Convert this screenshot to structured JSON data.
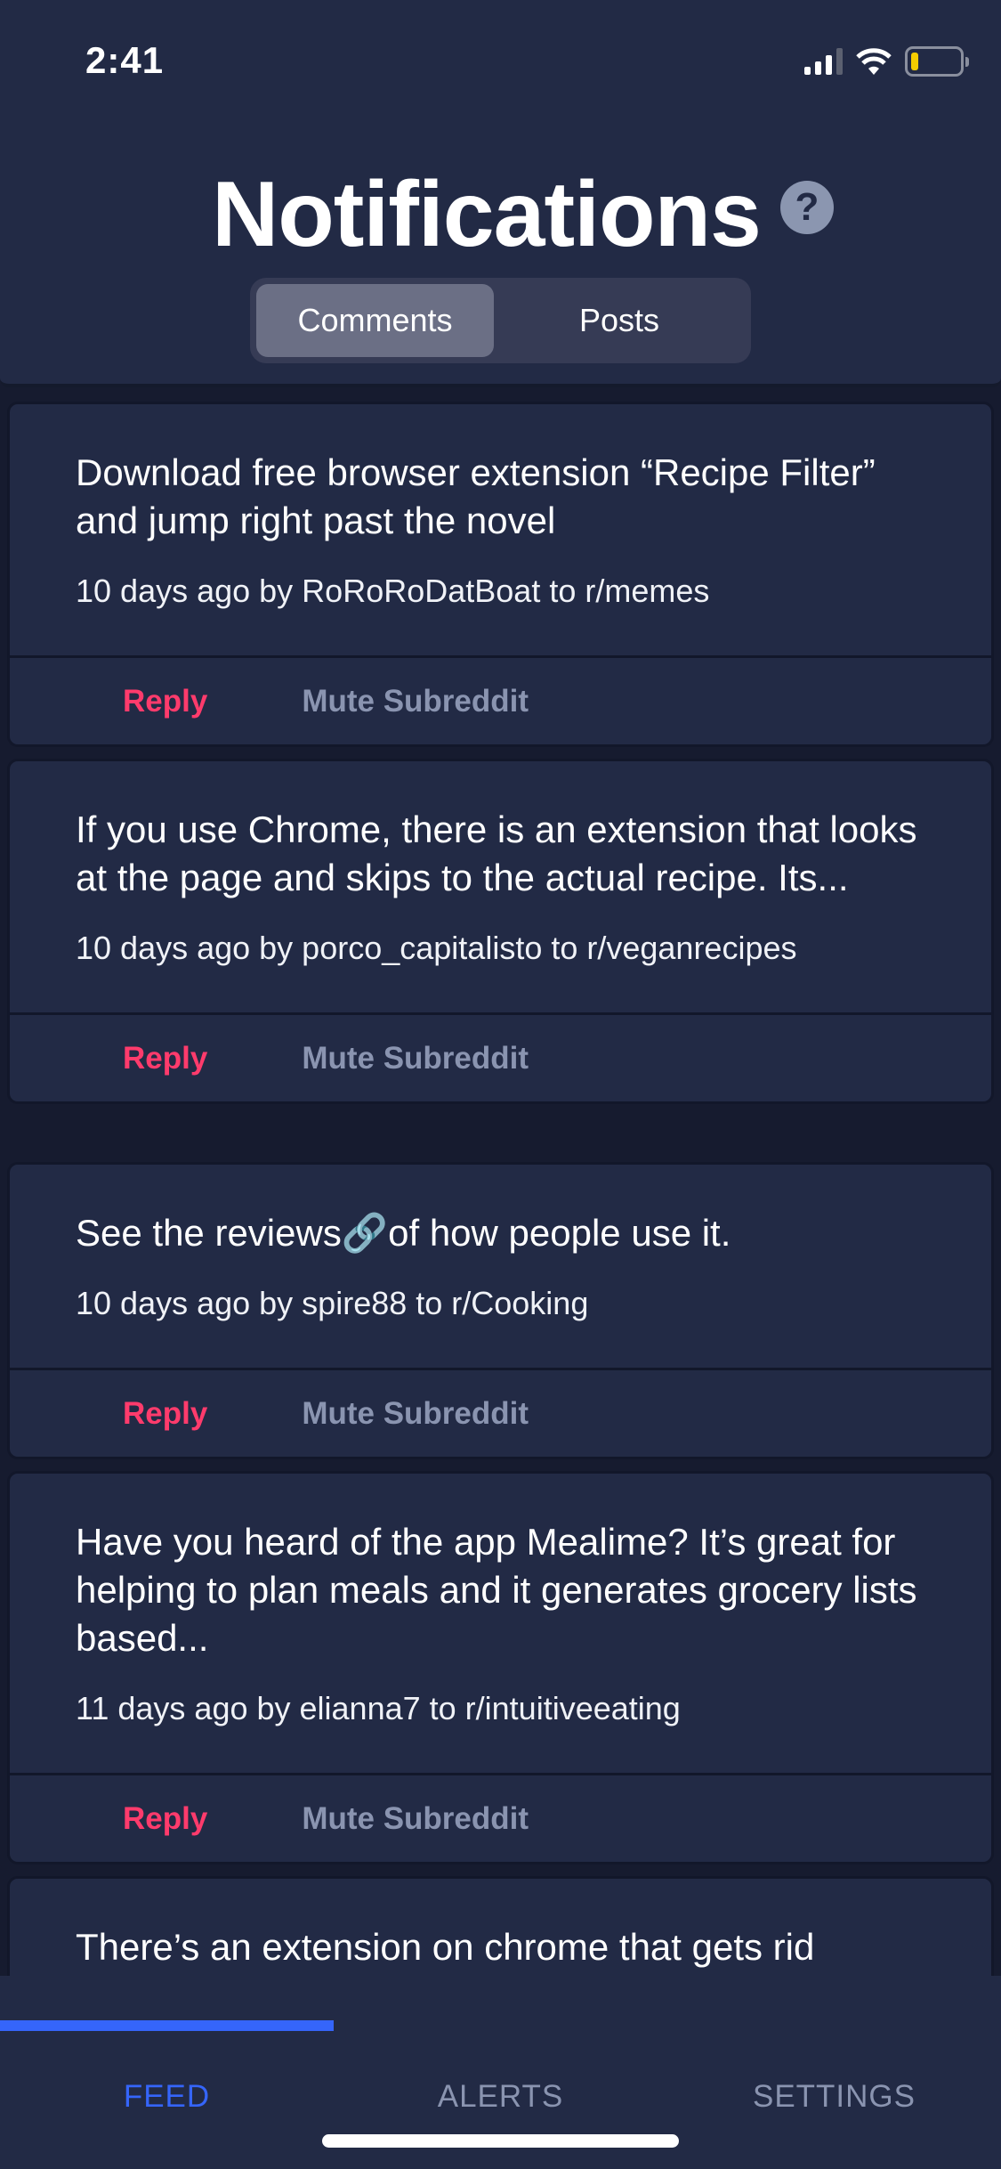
{
  "status": {
    "time": "2:41"
  },
  "header": {
    "title": "Notifications",
    "help_icon": "question-circle-icon",
    "tabs": [
      "Comments",
      "Posts"
    ],
    "active_tab": "Comments"
  },
  "colors": {
    "background": "#222a45",
    "reply": "#ff3b6c",
    "muted": "#8a94b0",
    "accent": "#3565fa",
    "battery": "#f5cc00"
  },
  "notifications": [
    {
      "text": "Download free browser extension “Recipe Filter” and jump right past the novel",
      "meta": "10 days ago by RoRoRoDatBoat to r/memes",
      "reply": "Reply",
      "mute": "Mute Subreddit"
    },
    {
      "text": "If you use Chrome, there is an extension that looks at the page and skips to the actual recipe. Its...",
      "meta": "10 days ago by porco_capitalisto to r/veganrecipes",
      "reply": "Reply",
      "mute": "Mute Subreddit"
    },
    {
      "text_before": "See the reviews",
      "link_icon": "🔗",
      "text_after": "of how people use it.",
      "meta": "10 days ago by spire88 to r/Cooking",
      "reply": "Reply",
      "mute": "Mute Subreddit"
    },
    {
      "text": "Have you heard of the app Mealime? It’s great for helping to plan meals and it generates grocery lists based...",
      "meta": "11 days ago by elianna7 to r/intuitiveeating",
      "reply": "Reply",
      "mute": "Mute Subreddit"
    },
    {
      "text": "There’s an extension on chrome that gets rid"
    }
  ],
  "tabbar": {
    "items": [
      "FEED",
      "ALERTS",
      "SETTINGS"
    ],
    "active": "FEED"
  }
}
